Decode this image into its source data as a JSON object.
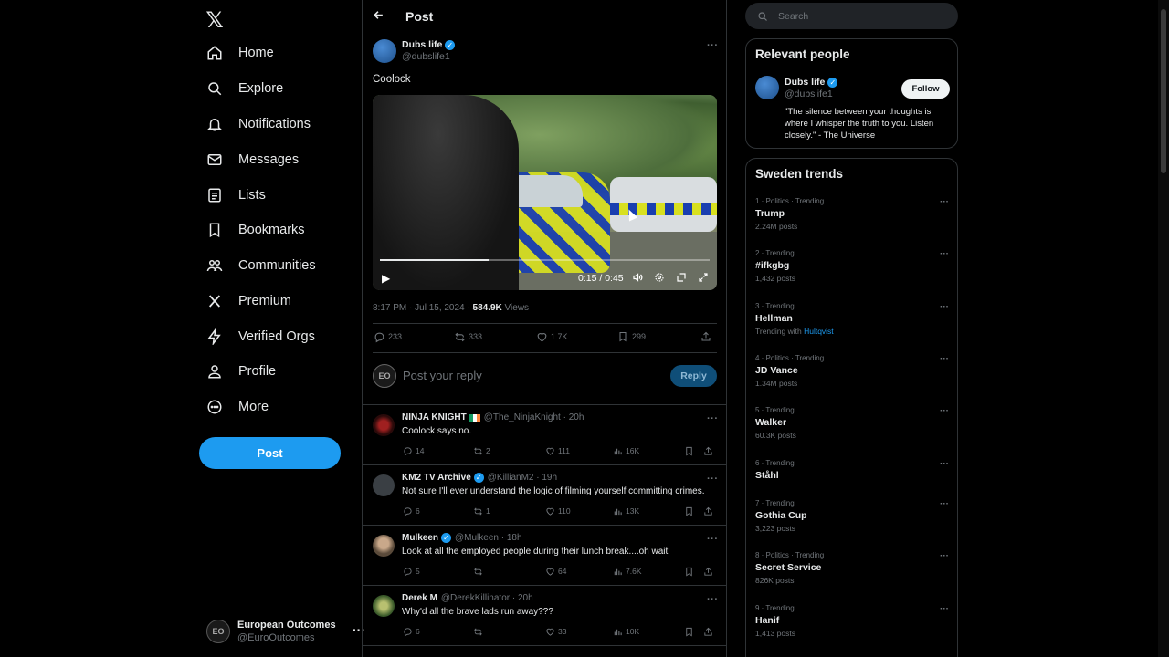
{
  "nav": {
    "logo": "𝕏",
    "items": [
      {
        "label": "Home",
        "icon": "home-icon"
      },
      {
        "label": "Explore",
        "icon": "search-icon"
      },
      {
        "label": "Notifications",
        "icon": "bell-icon"
      },
      {
        "label": "Messages",
        "icon": "mail-icon"
      },
      {
        "label": "Lists",
        "icon": "list-icon"
      },
      {
        "label": "Bookmarks",
        "icon": "bookmark-icon"
      },
      {
        "label": "Communities",
        "icon": "communities-icon"
      },
      {
        "label": "Premium",
        "icon": "x-icon"
      },
      {
        "label": "Verified Orgs",
        "icon": "lightning-icon"
      },
      {
        "label": "Profile",
        "icon": "person-icon"
      },
      {
        "label": "More",
        "icon": "more-circle-icon"
      }
    ],
    "post_button": "Post",
    "account": {
      "initials": "EO",
      "name": "European Outcomes",
      "handle": "@EuroOutcomes"
    }
  },
  "header": {
    "title": "Post"
  },
  "post": {
    "author_name": "Dubs life",
    "author_handle": "@dubslife1",
    "text": "Coolock",
    "video": {
      "time": "0:15 / 0:45",
      "progress": 0.33
    },
    "meta_time": "8:17 PM · Jul 15, 2024 · ",
    "views_count": "584.9K",
    "views_label": " Views",
    "stats": {
      "replies": "233",
      "reposts": "333",
      "likes": "1.7K",
      "bookmarks": "299"
    }
  },
  "reply_box": {
    "initials": "EO",
    "placeholder": "Post your reply",
    "button": "Reply"
  },
  "replies": [
    {
      "name": "NINJA KNIGHT",
      "flag": true,
      "verified": false,
      "handle": "@The_NinjaKnight · 20h",
      "text": "Coolock says no.",
      "replies": "14",
      "reposts": "2",
      "likes": "111",
      "views": "16K",
      "avatar_color": "#5a1a1a"
    },
    {
      "name": "KM2 TV Archive",
      "flag": false,
      "verified": true,
      "handle": "@KillianM2 · 19h",
      "text": "Not sure I'll ever understand the logic of filming yourself committing crimes.",
      "replies": "6",
      "reposts": "1",
      "likes": "110",
      "views": "13K",
      "avatar_color": "#3a3f44"
    },
    {
      "name": "Mulkeen",
      "flag": false,
      "verified": true,
      "handle": "@Mulkeen · 18h",
      "text": "Look at all the employed people during their lunch break....oh wait",
      "replies": "5",
      "reposts": "",
      "likes": "64",
      "views": "7.6K",
      "avatar_color": "#8a7a6a"
    },
    {
      "name": "Derek M",
      "flag": false,
      "verified": false,
      "handle": "@DerekKillinator · 20h",
      "text": "Why'd all the brave lads run away???",
      "replies": "6",
      "reposts": "",
      "likes": "33",
      "views": "10K",
      "avatar_color": "#4a6a3a"
    }
  ],
  "search": {
    "placeholder": "Search"
  },
  "relevant": {
    "title": "Relevant people",
    "name": "Dubs life",
    "handle": "@dubslife1",
    "follow": "Follow",
    "bio": "\"The silence between your thoughts is where I whisper the truth to you. Listen closely.\" - The Universe"
  },
  "trends": {
    "title": "Sweden trends",
    "items": [
      {
        "context": "1 · Politics · Trending",
        "name": "Trump",
        "count": "2.24M posts",
        "with": ""
      },
      {
        "context": "2 · Trending",
        "name": "#ifkgbg",
        "count": "1,432 posts",
        "with": ""
      },
      {
        "context": "3 · Trending",
        "name": "Hellman",
        "count": "Trending with ",
        "with": "Hultqvist"
      },
      {
        "context": "4 · Politics · Trending",
        "name": "JD Vance",
        "count": "1.34M posts",
        "with": ""
      },
      {
        "context": "5 · Trending",
        "name": "Walker",
        "count": "60.3K posts",
        "with": ""
      },
      {
        "context": "6 · Trending",
        "name": "Ståhl",
        "count": "",
        "with": ""
      },
      {
        "context": "7 · Trending",
        "name": "Gothia Cup",
        "count": "3,223 posts",
        "with": ""
      },
      {
        "context": "8 · Politics · Trending",
        "name": "Secret Service",
        "count": "826K posts",
        "with": ""
      },
      {
        "context": "9 · Trending",
        "name": "Hanif",
        "count": "1,413 posts",
        "with": ""
      }
    ]
  }
}
